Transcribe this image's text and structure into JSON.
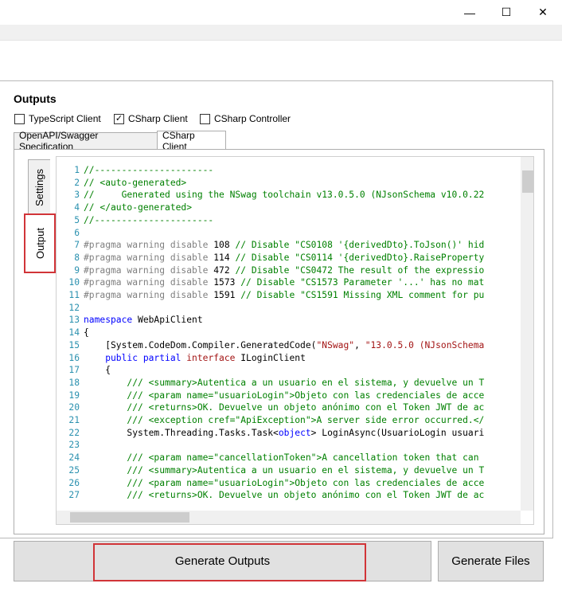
{
  "window": {
    "minimize_icon": "minimize-icon",
    "maximize_icon": "maximize-icon",
    "close_icon": "close-icon",
    "minimize_glyph": "—",
    "maximize_glyph": "☐",
    "close_glyph": "✕"
  },
  "outputs": {
    "title": "Outputs",
    "checkboxes": [
      {
        "label": "TypeScript Client",
        "checked": false
      },
      {
        "label": "CSharp Client",
        "checked": true
      },
      {
        "label": "CSharp Controller",
        "checked": false
      }
    ],
    "check_glyph": "✓"
  },
  "tabs": [
    {
      "label": "OpenAPI/Swagger Specification",
      "active": false
    },
    {
      "label": "CSharp Client",
      "active": true
    }
  ],
  "side_tabs": [
    {
      "label": "Settings",
      "active": false
    },
    {
      "label": "Output",
      "active": true
    }
  ],
  "code_lines": [
    {
      "n": "1",
      "parts": [
        {
          "c": "cm",
          "t": "//----------------------"
        }
      ]
    },
    {
      "n": "2",
      "parts": [
        {
          "c": "cm",
          "t": "// <auto-generated>"
        }
      ]
    },
    {
      "n": "3",
      "parts": [
        {
          "c": "cm",
          "t": "//     Generated using the NSwag toolchain v13.0.5.0 (NJsonSchema v10.0.22"
        }
      ]
    },
    {
      "n": "4",
      "parts": [
        {
          "c": "cm",
          "t": "// </auto-generated>"
        }
      ]
    },
    {
      "n": "5",
      "parts": [
        {
          "c": "cm",
          "t": "//----------------------"
        }
      ]
    },
    {
      "n": "6",
      "parts": []
    },
    {
      "n": "7",
      "parts": [
        {
          "c": "dir",
          "t": "#pragma warning disable "
        },
        {
          "c": "",
          "t": "108 "
        },
        {
          "c": "cm",
          "t": "// Disable \"CS0108 '{derivedDto}.ToJson()' hid"
        }
      ]
    },
    {
      "n": "8",
      "parts": [
        {
          "c": "dir",
          "t": "#pragma warning disable "
        },
        {
          "c": "",
          "t": "114 "
        },
        {
          "c": "cm",
          "t": "// Disable \"CS0114 '{derivedDto}.RaiseProperty"
        }
      ]
    },
    {
      "n": "9",
      "parts": [
        {
          "c": "dir",
          "t": "#pragma warning disable "
        },
        {
          "c": "",
          "t": "472 "
        },
        {
          "c": "cm",
          "t": "// Disable \"CS0472 The result of the expressio"
        }
      ]
    },
    {
      "n": "10",
      "parts": [
        {
          "c": "dir",
          "t": "#pragma warning disable "
        },
        {
          "c": "",
          "t": "1573 "
        },
        {
          "c": "cm",
          "t": "// Disable \"CS1573 Parameter '...' has no mat"
        }
      ]
    },
    {
      "n": "11",
      "parts": [
        {
          "c": "dir",
          "t": "#pragma warning disable "
        },
        {
          "c": "",
          "t": "1591 "
        },
        {
          "c": "cm",
          "t": "// Disable \"CS1591 Missing XML comment for pu"
        }
      ]
    },
    {
      "n": "12",
      "parts": []
    },
    {
      "n": "13",
      "parts": [
        {
          "c": "kw",
          "t": "namespace "
        },
        {
          "c": "",
          "t": "WebApiClient"
        }
      ]
    },
    {
      "n": "14",
      "parts": [
        {
          "c": "",
          "t": "{"
        }
      ]
    },
    {
      "n": "15",
      "parts": [
        {
          "c": "",
          "t": "    [System.CodeDom.Compiler.GeneratedCode("
        },
        {
          "c": "str",
          "t": "\"NSwag\""
        },
        {
          "c": "",
          "t": ", "
        },
        {
          "c": "str",
          "t": "\"13.0.5.0 (NJsonSchema"
        }
      ]
    },
    {
      "n": "16",
      "parts": [
        {
          "c": "kw",
          "t": "    public partial "
        },
        {
          "c": "prp",
          "t": "interface "
        },
        {
          "c": "",
          "t": "ILoginClient"
        }
      ]
    },
    {
      "n": "17",
      "parts": [
        {
          "c": "",
          "t": "    {"
        }
      ]
    },
    {
      "n": "18",
      "parts": [
        {
          "c": "cm",
          "t": "        /// <summary>Autentica a un usuario en el sistema, y devuelve un T"
        }
      ]
    },
    {
      "n": "19",
      "parts": [
        {
          "c": "cm",
          "t": "        /// <param name=\"usuarioLogin\">Objeto con las credenciales de acce"
        }
      ]
    },
    {
      "n": "20",
      "parts": [
        {
          "c": "cm",
          "t": "        /// <returns>OK. Devuelve un objeto anónimo con el Token JWT de ac"
        }
      ]
    },
    {
      "n": "21",
      "parts": [
        {
          "c": "cm",
          "t": "        /// <exception cref=\"ApiException\">A server side error occurred.</"
        }
      ]
    },
    {
      "n": "22",
      "parts": [
        {
          "c": "",
          "t": "        System.Threading.Tasks.Task<"
        },
        {
          "c": "kw",
          "t": "object"
        },
        {
          "c": "",
          "t": "> LoginAsync(UsuarioLogin usuari"
        }
      ]
    },
    {
      "n": "23",
      "parts": []
    },
    {
      "n": "24",
      "parts": [
        {
          "c": "cm",
          "t": "        /// <param name=\"cancellationToken\">A cancellation token that can"
        }
      ]
    },
    {
      "n": "25",
      "parts": [
        {
          "c": "cm",
          "t": "        /// <summary>Autentica a un usuario en el sistema, y devuelve un T"
        }
      ]
    },
    {
      "n": "26",
      "parts": [
        {
          "c": "cm",
          "t": "        /// <param name=\"usuarioLogin\">Objeto con las credenciales de acce"
        }
      ]
    },
    {
      "n": "27",
      "parts": [
        {
          "c": "cm",
          "t": "        /// <returns>OK. Devuelve un objeto anónimo con el Token JWT de ac"
        }
      ]
    }
  ],
  "buttons": {
    "generate_outputs": "Generate Outputs",
    "generate_files": "Generate Files"
  },
  "colors": {
    "highlight": "#d13438",
    "comment": "#008000",
    "keyword": "#0000ff",
    "line_number": "#2b91af"
  }
}
